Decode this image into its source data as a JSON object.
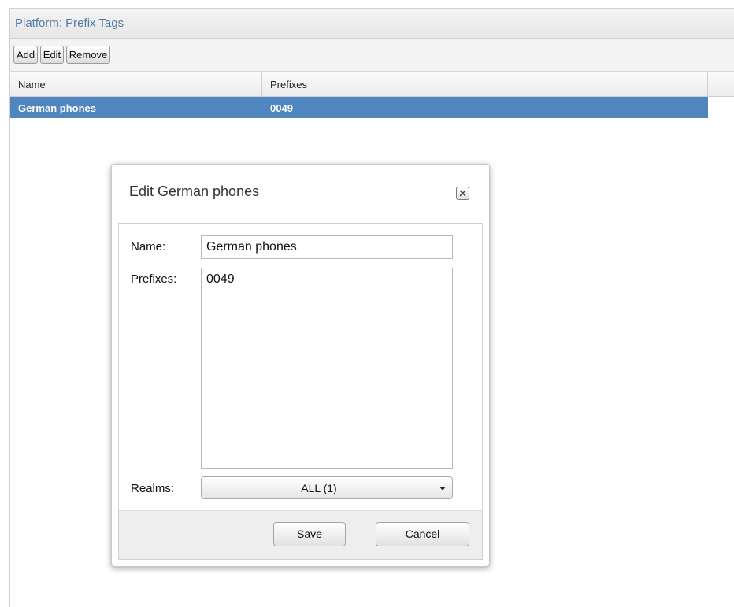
{
  "panel": {
    "title": "Platform: Prefix Tags"
  },
  "toolbar": {
    "add_label": "Add",
    "edit_label": "Edit",
    "remove_label": "Remove"
  },
  "grid": {
    "columns": [
      "Name",
      "Prefixes"
    ],
    "rows": [
      {
        "name": "German phones",
        "prefixes": "0049",
        "selected": true
      }
    ],
    "selected_row_color": "#4f86c0"
  },
  "dialog": {
    "title": "Edit German phones",
    "close_icon": "close-icon",
    "name_label": "Name:",
    "name_value": "German phones",
    "prefixes_label": "Prefixes:",
    "prefixes_value": "0049",
    "realms_label": "Realms:",
    "realms_value": "ALL (1)",
    "save_label": "Save",
    "cancel_label": "Cancel"
  },
  "colors": {
    "header_text": "#4f7aa4"
  }
}
